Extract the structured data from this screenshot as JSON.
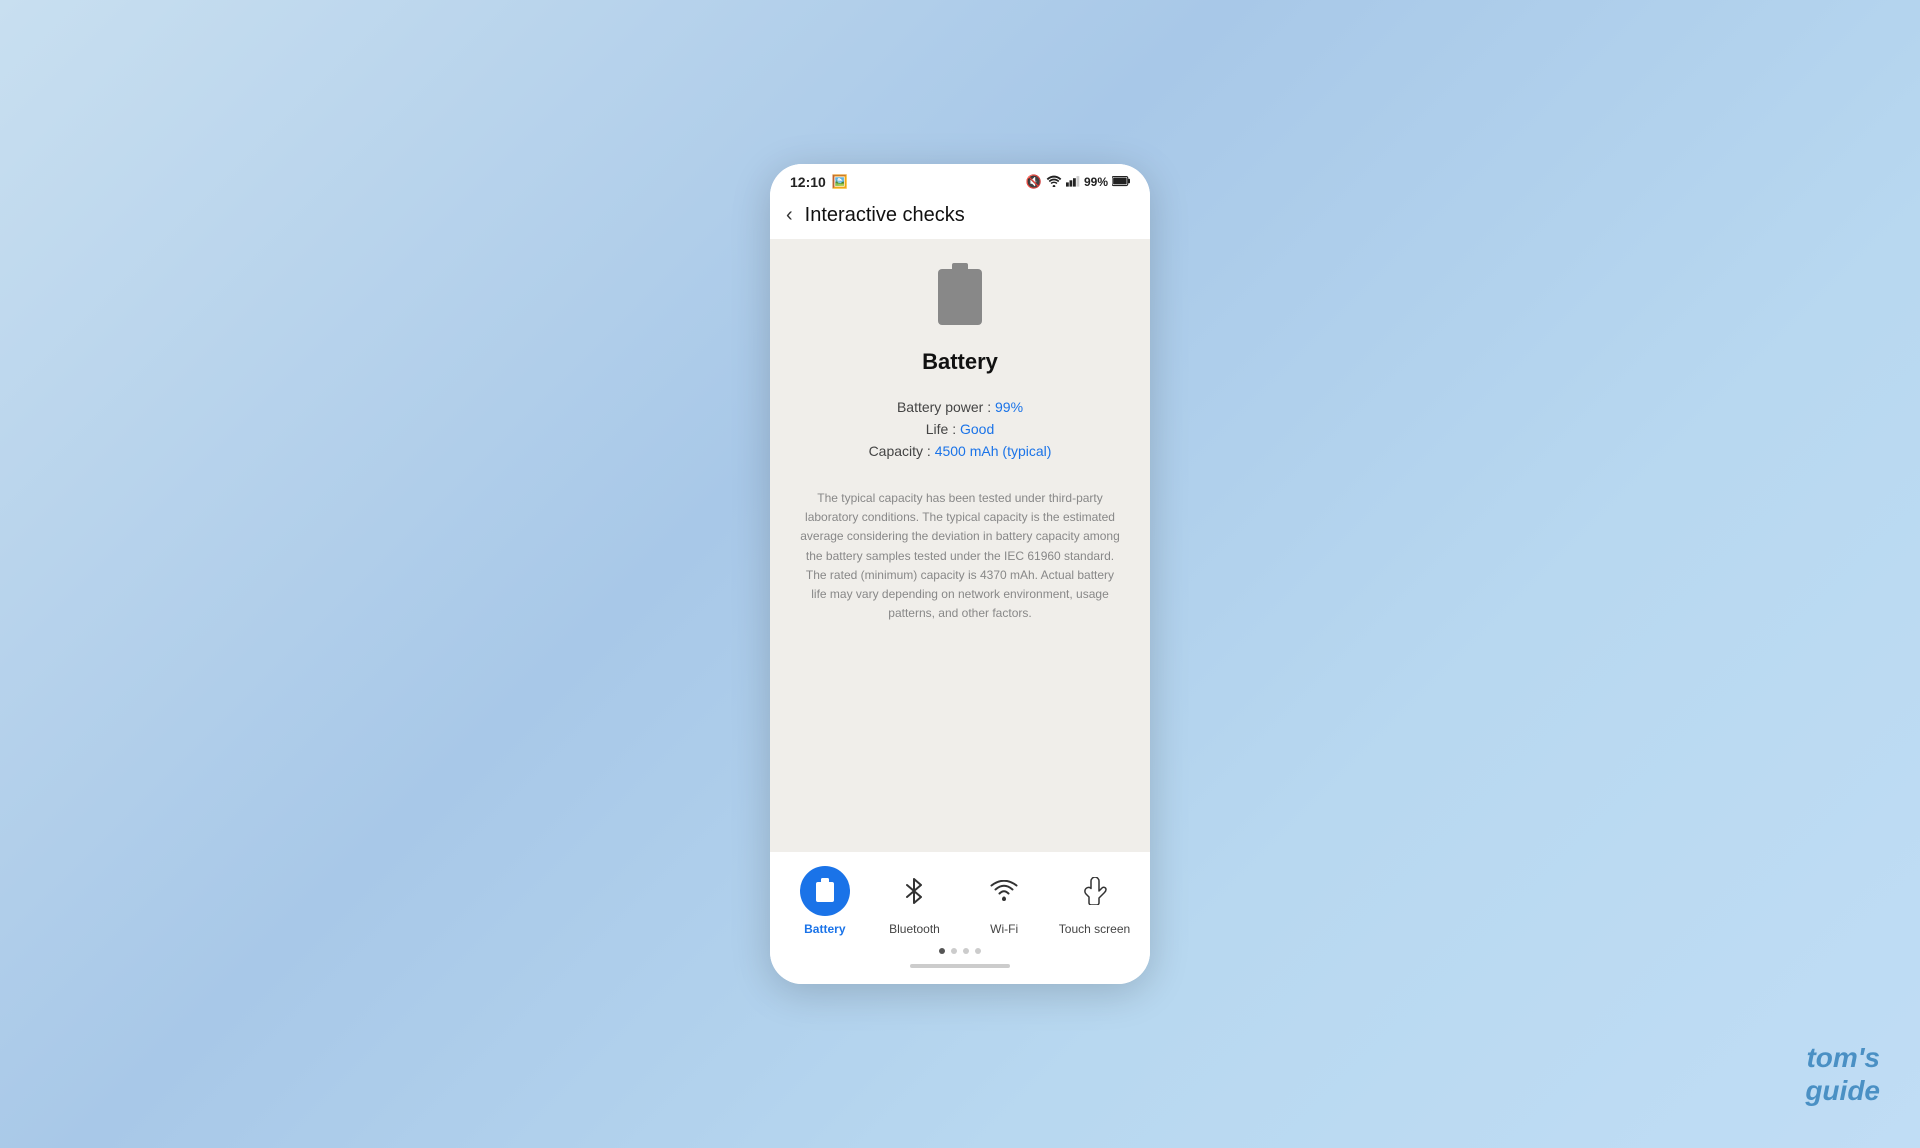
{
  "watermark": {
    "line1": "tom's",
    "line2": "guide"
  },
  "status_bar": {
    "time": "12:10",
    "battery_percent": "99%",
    "icons": {
      "mute": "🔇",
      "wifi": "wifi",
      "signal": "signal",
      "battery": "battery"
    }
  },
  "header": {
    "back_label": "‹",
    "title": "Interactive checks"
  },
  "main": {
    "battery_section_title": "Battery",
    "stats": {
      "power_label": "Battery power : ",
      "power_value": "99%",
      "life_label": "Life : ",
      "life_value": "Good",
      "capacity_label": "Capacity : ",
      "capacity_value": "4500 mAh (typical)"
    },
    "disclaimer": "The typical capacity has been tested under third-party laboratory conditions. The typical capacity is the estimated average considering the deviation in battery capacity among the battery samples tested under the IEC 61960 standard. The rated (minimum) capacity is 4370 mAh. Actual battery life may vary depending on network environment, usage patterns, and other factors."
  },
  "bottom_nav": {
    "items": [
      {
        "id": "battery",
        "label": "Battery",
        "active": true
      },
      {
        "id": "bluetooth",
        "label": "Bluetooth",
        "active": false
      },
      {
        "id": "wifi",
        "label": "Wi-Fi",
        "active": false
      },
      {
        "id": "touchscreen",
        "label": "Touch screen",
        "active": false
      }
    ],
    "pagination_dots": 4,
    "active_dot": 0
  }
}
